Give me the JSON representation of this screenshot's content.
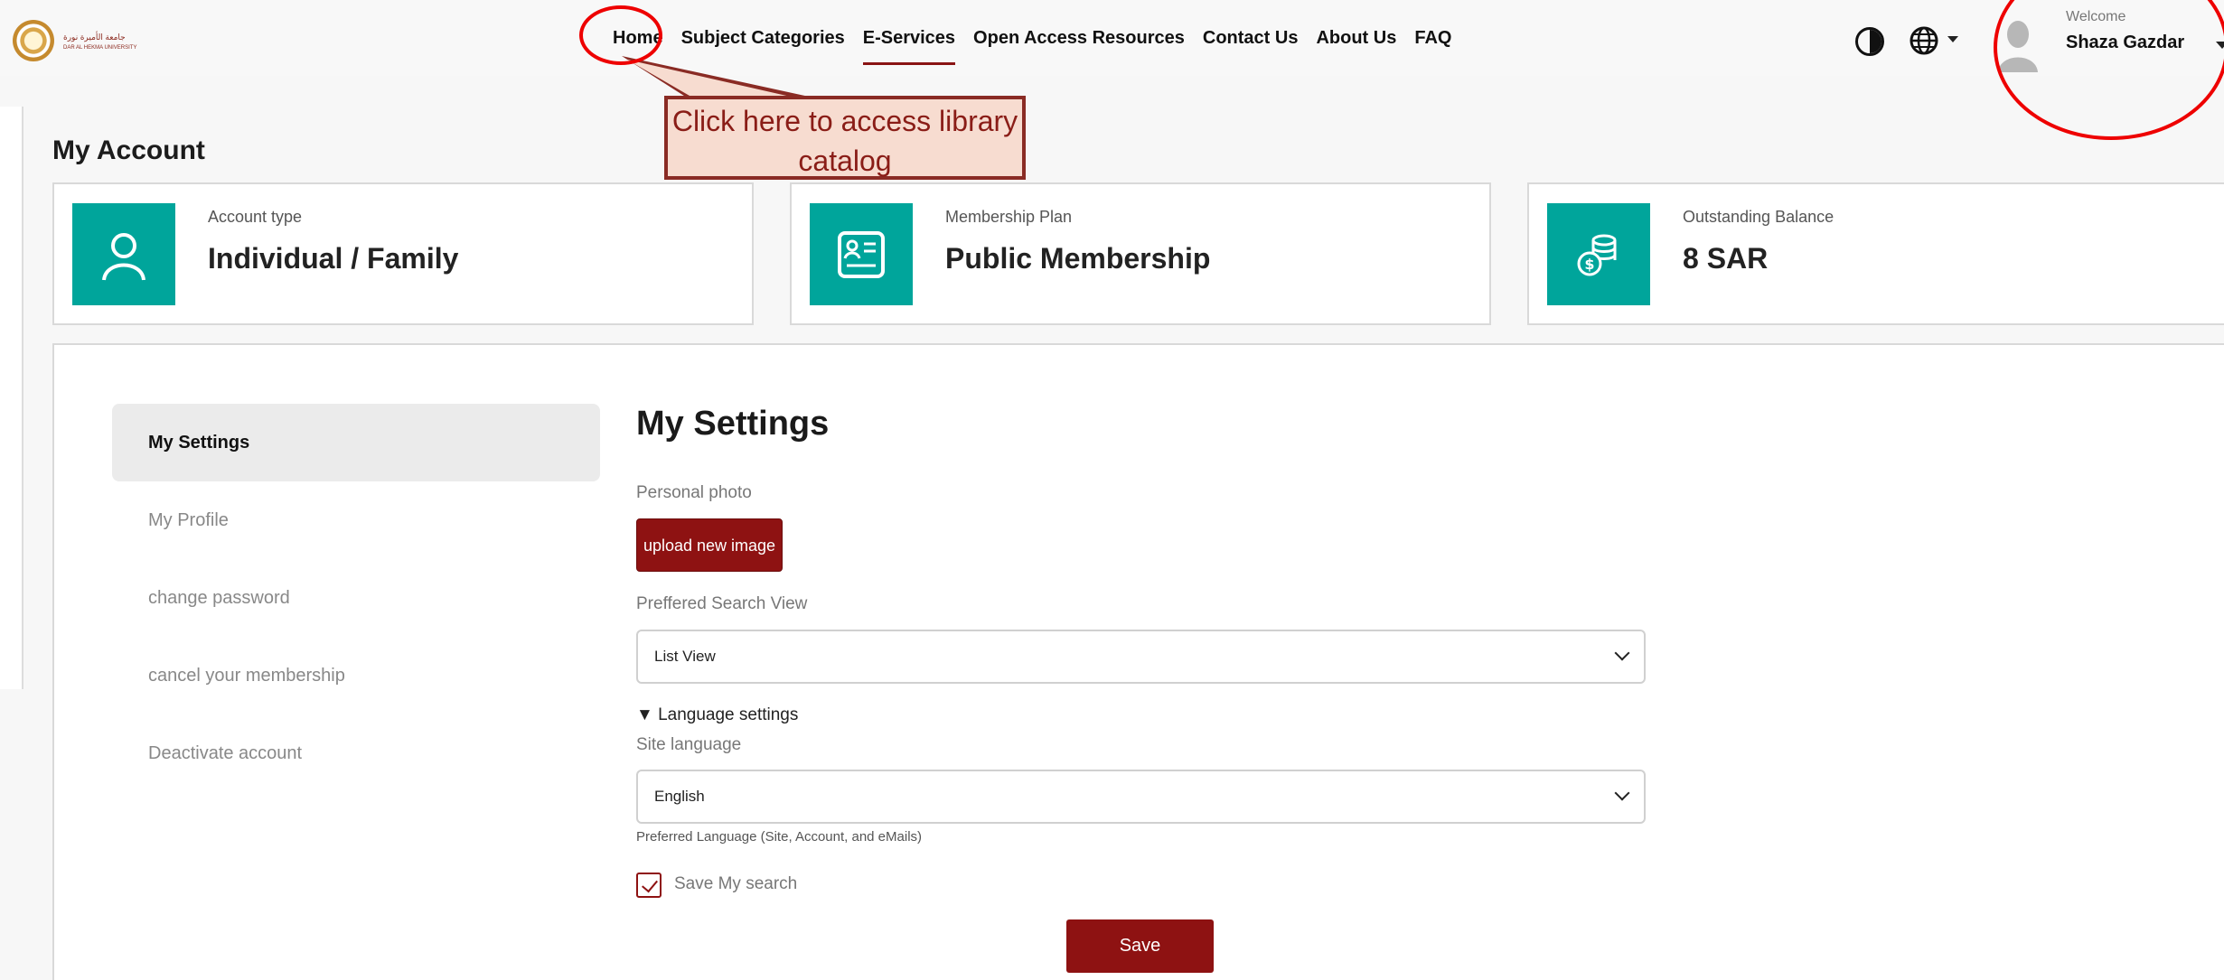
{
  "brand": {
    "logo_text": "جامعة الأميرة نورة",
    "logo_subtext": "DAR AL HEKMA UNIVERSITY"
  },
  "nav": {
    "items": [
      "Home",
      "Subject Categories",
      "E-Services",
      "Open Access Resources",
      "Contact Us",
      "About Us",
      "FAQ"
    ],
    "active": "E-Services"
  },
  "user": {
    "welcome": "Welcome",
    "name": "Shaza Gazdar"
  },
  "annotation": {
    "callout_text": "Click here to access library catalog",
    "color": "#e00000"
  },
  "page_title": "My Account",
  "cards": [
    {
      "label": "Account type",
      "value": "Individual / Family",
      "icon": "user-icon"
    },
    {
      "label": "Membership Plan",
      "value": "Public Membership",
      "icon": "id-card-icon"
    },
    {
      "label": "Outstanding Balance",
      "value": "8 SAR",
      "icon": "coins-icon"
    }
  ],
  "sidebar": {
    "items": [
      "My Settings",
      "My Profile",
      "change password",
      "cancel your membership",
      "Deactivate account"
    ],
    "active": "My Settings"
  },
  "settings": {
    "title": "My Settings",
    "personal_photo_label": "Personal photo",
    "upload_label": "upload new image",
    "search_view_label": "Preffered Search View",
    "search_view_value": "List View",
    "language_section": "▼ Language settings",
    "site_language_label": "Site language",
    "site_language_value": "English",
    "language_hint": "Preferred Language (Site, Account, and eMails)",
    "save_search_label": "Save My search",
    "save_search_checked": true,
    "save_label": "Save"
  },
  "colors": {
    "accent": "#8e1212",
    "tile": "#00a59b"
  }
}
